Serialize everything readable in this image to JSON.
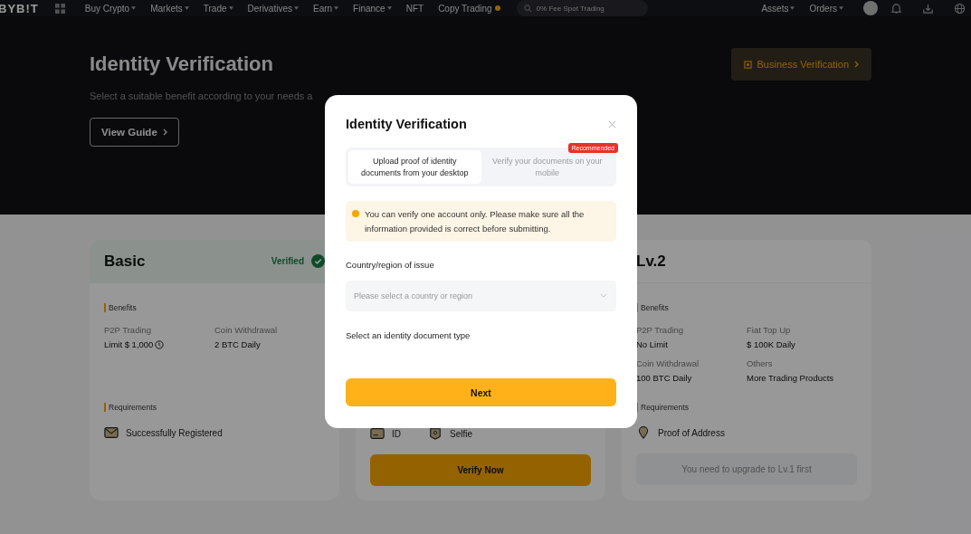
{
  "nav": {
    "logo": "BYB!T",
    "menu": [
      {
        "label": "Buy Crypto",
        "caret": true,
        "dot": false
      },
      {
        "label": "Markets",
        "caret": true,
        "dot": false
      },
      {
        "label": "Trade",
        "caret": true,
        "dot": false
      },
      {
        "label": "Derivatives",
        "caret": true,
        "dot": false
      },
      {
        "label": "Earn",
        "caret": true,
        "dot": false
      },
      {
        "label": "Finance",
        "caret": true,
        "dot": false
      },
      {
        "label": "NFT",
        "caret": false,
        "dot": false
      },
      {
        "label": "Copy Trading",
        "caret": false,
        "dot": true
      }
    ],
    "search": {
      "placeholder": "0% Fee Spot Trading"
    },
    "right": [
      {
        "label": "Assets",
        "caret": true
      },
      {
        "label": "Orders",
        "caret": true
      }
    ]
  },
  "hero": {
    "title": "Identity Verification",
    "subtitle": "Select a suitable benefit according to your needs a",
    "guide_button": "View Guide",
    "business_button": "Business Verification"
  },
  "levels": [
    {
      "title": "Basic",
      "status_label": "Verified",
      "benefits_label": "Benefits",
      "benefits": [
        {
          "label": "P2P Trading",
          "value": "Limit $ 1,000",
          "info": true
        },
        {
          "label": "Coin Withdrawal",
          "value": "2 BTC Daily",
          "info": false
        }
      ],
      "requirements_label": "Requirements",
      "requirements": [
        {
          "label": "Successfully Registered",
          "kind": "envelope"
        }
      ]
    },
    {
      "requirements": [
        {
          "label": "ID",
          "kind": "id"
        },
        {
          "label": "Selfie",
          "kind": "selfie"
        }
      ],
      "action": {
        "label": "Verify Now",
        "disabled": false
      }
    },
    {
      "title": "Lv.2",
      "benefits_label": "Benefits",
      "benefits": [
        {
          "label": "P2P Trading",
          "value": "No Limit",
          "info": false
        },
        {
          "label": "Fiat Top Up",
          "value": "$ 100K Daily",
          "info": false
        },
        {
          "label": "Coin Withdrawal",
          "value": "100 BTC Daily",
          "info": false
        },
        {
          "label": "Others",
          "value": "More Trading Products",
          "info": false
        }
      ],
      "requirements_label": "Requirements",
      "requirements": [
        {
          "label": "Proof of Address",
          "kind": "pin"
        }
      ],
      "action": {
        "label": "You need to upgrade to Lv.1 first",
        "disabled": true
      }
    }
  ],
  "modal": {
    "title": "Identity Verification",
    "tabs": [
      {
        "label": "Upload proof of identity documents from your desktop",
        "selected": true
      },
      {
        "label": "Verify your documents on your mobile",
        "selected": false,
        "badge": "Recommended"
      }
    ],
    "notice": "You can verify one account only. Please make sure all the information provided is correct before submitting.",
    "country_label": "Country/region of issue",
    "country_select": {
      "placeholder": "Please select a country or region"
    },
    "document_label": "Select an identity document type",
    "next_button": "Next"
  }
}
